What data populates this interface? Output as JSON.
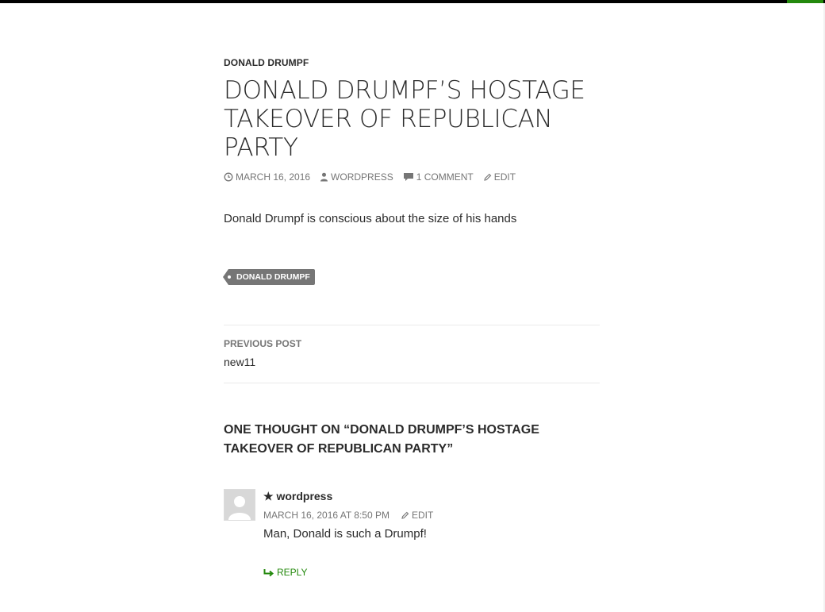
{
  "post": {
    "category": "DONALD DRUMPF",
    "title": "DONALD DRUMPF’S HOSTAGE TAKEOVER OF REPUBLICAN PARTY",
    "meta": {
      "date": "MARCH 16, 2016",
      "author": "WORDPRESS",
      "comments": "1 COMMENT",
      "edit": "EDIT"
    },
    "content": "Donald Drumpf is conscious about the size of his hands",
    "tag": "DONALD DRUMPF"
  },
  "post_navigation": {
    "label": "PREVIOUS POST",
    "title": "new11"
  },
  "comments": {
    "title": "ONE THOUGHT ON “DONALD DRUMPF’S HOSTAGE TAKEOVER OF REPUBLICAN PARTY”",
    "items": [
      {
        "author": "wordpress",
        "date": "MARCH 16, 2016 AT 8:50 PM",
        "edit": "EDIT",
        "text": "Man, Donald is such a Drumpf!",
        "reply": "REPLY"
      }
    ]
  },
  "colors": {
    "accent": "#24890d",
    "topbar": "#000000",
    "meta": "#767676",
    "text": "#2b2b2b"
  },
  "icons": {
    "date": "clock-icon",
    "author": "person-icon",
    "comments": "speech-bubble-icon",
    "edit": "pencil-icon",
    "comment_author_badge": "star-icon",
    "reply": "reply-arrow-icon",
    "avatar": "default-avatar-icon"
  }
}
